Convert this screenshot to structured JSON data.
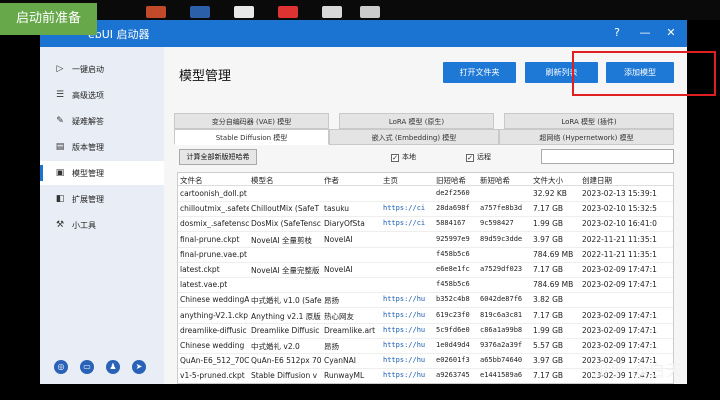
{
  "badge": {
    "text": "启动前准备"
  },
  "window": {
    "title": "ebUI 启动器",
    "help": "?",
    "minimize": "—",
    "close": "✕"
  },
  "sidebar": {
    "items": [
      {
        "label": "一键启动",
        "icon": "play-icon"
      },
      {
        "label": "高级选项",
        "icon": "sliders-icon"
      },
      {
        "label": "疑难解答",
        "icon": "wrench-icon"
      },
      {
        "label": "版本管理",
        "icon": "document-icon"
      },
      {
        "label": "模型管理",
        "icon": "cube-icon"
      },
      {
        "label": "扩展管理",
        "icon": "puzzle-icon"
      },
      {
        "label": "小工具",
        "icon": "tools-icon"
      }
    ],
    "bottom_icons": [
      "globe-icon",
      "bilibili-icon",
      "qq-icon",
      "telegram-icon"
    ]
  },
  "main": {
    "title": "模型管理",
    "buttons": {
      "open_folder": "打开文件夹",
      "refresh": "刷新列表",
      "add_model": "添加模型"
    },
    "tabs_row1": [
      "变分自编码器 (VAE) 模型",
      "LoRA 模型 (原生)",
      "LoRA 模型 (插件)"
    ],
    "tabs_row2": [
      "Stable Diffusion 模型",
      "嵌入式 (Embedding) 模型",
      "超网络 (Hypernetwork) 模型"
    ],
    "calc_button": "计算全部新版短哈希",
    "check_local": "本地",
    "check_remote": "远程",
    "checked_mark": "✓",
    "search": ""
  },
  "table": {
    "headers": [
      "文件名",
      "模型名",
      "作者",
      "主页",
      "旧短哈希",
      "新短哈希",
      "文件大小",
      "创建日期"
    ],
    "rows": [
      [
        "cartoonish_doll.pt",
        "",
        "",
        "",
        "de2f2560",
        "",
        "32.92 KB",
        "2023-02-13 15:39:1"
      ],
      [
        "chilloutmix_.safete",
        "ChilloutMix (SafeT",
        "tasuku",
        "https://ci",
        "28da698f",
        "a757fe8b3d",
        "7.17 GB",
        "2023-02-10 15:32:5"
      ],
      [
        "dosmix_.safetensc",
        "DosMix (SafeTensc",
        "DiaryOfSta",
        "https://ci",
        "5884167",
        "9c598427",
        "1.99 GB",
        "2023-02-10 16:41:0"
      ],
      [
        "final-prune.ckpt",
        "NovelAI 全量剪枝",
        "NovelAI",
        "",
        "925997e9",
        "89d59c3dde",
        "3.97 GB",
        "2022-11-21 11:35:1"
      ],
      [
        "final-prune.vae.pt",
        "",
        "",
        "",
        "f458b5c6",
        "",
        "784.69 MB",
        "2022-11-21 11:35:1"
      ],
      [
        "latest.ckpt",
        "NovelAI 全量完整版",
        "NovelAI",
        "",
        "e6e8e1fc",
        "a7529df023",
        "7.17 GB",
        "2023-02-09 17:47:1"
      ],
      [
        "latest.vae.pt",
        "",
        "",
        "",
        "f458b5c6",
        "",
        "784.69 MB",
        "2023-02-09 17:47:1"
      ],
      [
        "Chinese weddingA",
        "中式婚礼 v1.0 (Safe",
        "昂扬",
        "https://hu",
        "b352c4b8",
        "6042de87f6",
        "3.82 GB",
        ""
      ],
      [
        "anything-V2.1.ckp",
        "Anything v2.1 原版",
        "热心网友",
        "https://hu",
        "619c23f0",
        "819c6a3c81",
        "7.17 GB",
        "2023-02-09 17:47:1"
      ],
      [
        "dreamlike-diffusic",
        "Dreamlike Diffusic",
        "Dreamlike.art",
        "https://hu",
        "5c9fd6e0",
        "c86a1a99b8",
        "1.99 GB",
        "2023-02-09 17:47:1"
      ],
      [
        "Chinese wedding",
        "中式婚礼 v2.0",
        "昂扬",
        "https://hu",
        "1e0d49d4",
        "9376a2a39f",
        "5.57 GB",
        "2023-02-09 17:47:1"
      ],
      [
        "QuAn-E6_512_70C",
        "QuAn-E6 512px 70",
        "CyanNAI",
        "https://hu",
        "e02601f3",
        "a65bb74640",
        "3.97 GB",
        "2023-02-09 17:47:1"
      ],
      [
        "v1-5-pruned.ckpt",
        "Stable Diffusion v",
        "RunwayML",
        "https://hu",
        "a9263745",
        "e1441589a6",
        "7.17 GB",
        "2023-02-09 17:47:1"
      ]
    ]
  },
  "watermark": "知乎 @白天"
}
